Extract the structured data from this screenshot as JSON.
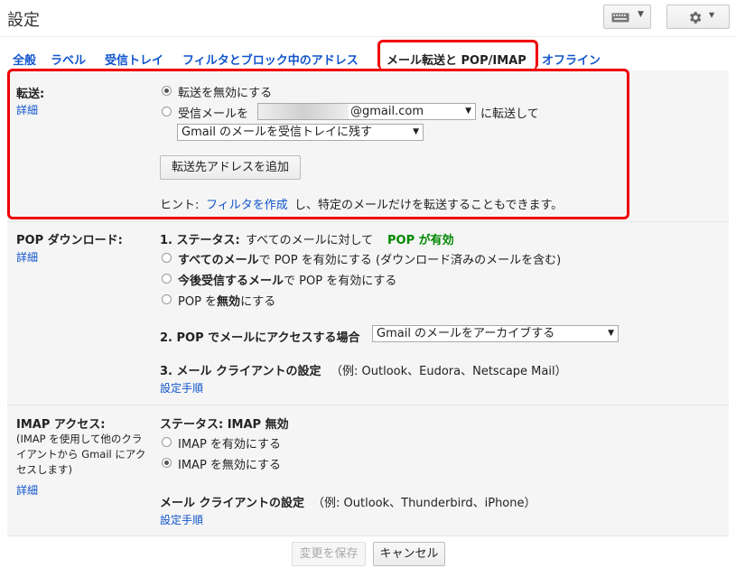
{
  "page_title": "設定",
  "toolbar": {
    "keyboard_icon": "keyboard-icon",
    "gear_icon": "gear-icon"
  },
  "tabs": [
    "全般",
    "ラベル",
    "受信トレイ",
    "フィルタとブロック中のアドレス",
    "メール転送と POP/IMAP",
    "オフライン"
  ],
  "forwarding": {
    "label": "転送:",
    "details_link": "詳細",
    "disable_option": "転送を無効にする",
    "forward_prefix": "受信メールを",
    "address_value": "@gmail.com",
    "forward_suffix": "に転送して",
    "keep_select": "Gmail のメールを受信トレイに残す",
    "add_button": "転送先アドレスを追加",
    "hint_prefix": "ヒント:",
    "hint_link": "フィルタを作成",
    "hint_suffix": "し、特定のメールだけを転送することもできます。"
  },
  "pop": {
    "label": "POP ダウンロード:",
    "details_link": "詳細",
    "status_title": "1. ステータス:",
    "status_text": "すべてのメールに対して",
    "status_value": "POP が有効",
    "opt1_bold": "すべてのメール",
    "opt1_rest": "で POP を有効にする (ダウンロード済みのメールを含む)",
    "opt2_bold": "今後受信するメール",
    "opt2_rest": "で POP を有効にする",
    "opt3_prefix": "POP を",
    "opt3_bold": "無効",
    "opt3_rest": "にする",
    "access_title": "2. POP でメールにアクセスする場合",
    "access_select": "Gmail のメールをアーカイブする",
    "client_title": "3. メール クライアントの設定",
    "client_examples": "（例: Outlook、Eudora、Netscape Mail）",
    "setup_link": "設定手順"
  },
  "imap": {
    "label": "IMAP アクセス:",
    "desc": "(IMAP を使用して他のクライアントから Gmail にアクセスします)",
    "details_link": "詳細",
    "status": "ステータス: IMAP 無効",
    "enable_option": "IMAP を有効にする",
    "disable_option": "IMAP を無効にする",
    "client_title": "メール クライアントの設定",
    "client_examples": "（例: Outlook、Thunderbird、iPhone）",
    "setup_link": "設定手順"
  },
  "footer": {
    "save_button": "変更を保存",
    "cancel_button": "キャンセル"
  }
}
